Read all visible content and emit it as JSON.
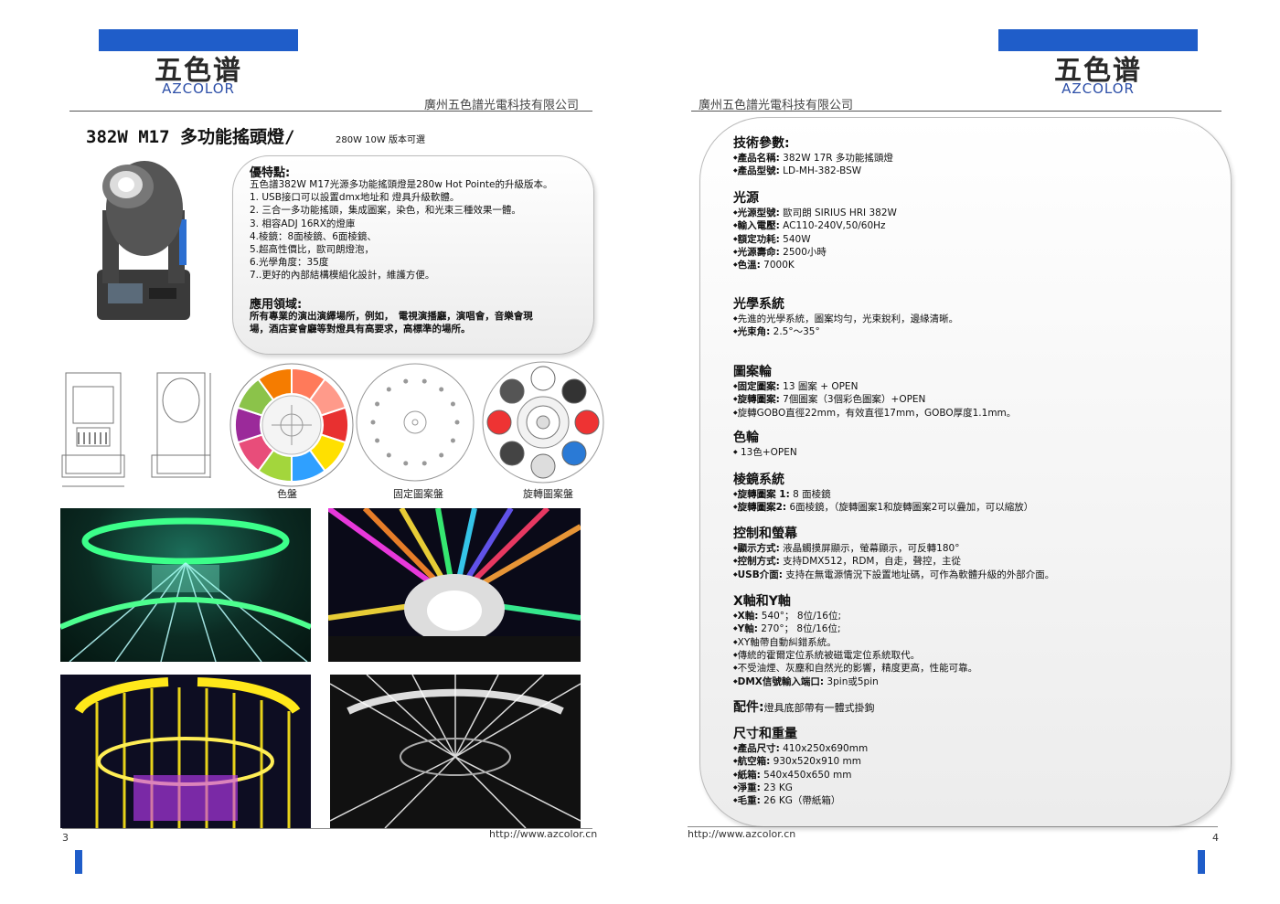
{
  "logo": {
    "cn": "五色谱",
    "en": "AZCOLOR"
  },
  "company": "廣州五色譜光電科技有限公司",
  "left": {
    "title": "382W M17 多功能搖頭燈/",
    "subtitle": "280W 10W 版本可選",
    "features_title": "優特點:",
    "features": [
      "五色譜382W M17光源多功能搖頭燈是280w Hot Pointe的升級版本。",
      "1. USB接口可以設置dmx地址和 燈具升級軟體。",
      "2. 三合一多功能搖頭，集成圖案，染色，和光束三種效果一體。",
      "3. 相容ADJ 16RX的燈庫",
      "4.棱鏡：8面棱鏡、6面棱鏡、",
      "5.超高性價比，歐司朗燈泡，",
      "6.光學角度：35度",
      "7..更好的內部結構模組化設計，維護方便。"
    ],
    "app_title": "應用領域:",
    "app_lines": [
      "所有專業的演出演繹場所，例如，　電視演播廳，演唱會，音樂會現",
      "場，酒店宴會廳等對燈具有高要求，高標準的場所。"
    ],
    "captions": [
      "色盤",
      "固定圖案盤",
      "旋轉圖案盤"
    ],
    "page_no": "3",
    "url": "http://www.azcolor.cn"
  },
  "right": {
    "page_no": "4",
    "url": "http://www.azcolor.cn",
    "sections": [
      {
        "title": "技術參數:",
        "items": [
          {
            "k": "產品名稱:",
            "v": " 382W 17R 多功能搖頭燈"
          },
          {
            "k": "產品型號:",
            "v": " LD-MH-382-BSW"
          }
        ]
      },
      {
        "title": "光源",
        "items": [
          {
            "k": "光源型號:",
            "v": " 歐司朗 SIRIUS HRI 382W"
          },
          {
            "k": "輸入電壓:",
            "v": " AC110-240V,50/60Hz"
          },
          {
            "k": "額定功耗:",
            "v": " 540W"
          },
          {
            "k": "光源壽命:",
            "v": " 2500小時"
          },
          {
            "k": "色溫:",
            "v": " 7000K"
          }
        ]
      },
      {
        "title": "光學系統",
        "items": [
          {
            "k": "",
            "v": "先進的光學系統，圖案均勻，光束銳利，邊緣清晰。"
          },
          {
            "k": "光束角:",
            "v": " 2.5°～35°"
          }
        ]
      },
      {
        "title": "圖案輪",
        "items": [
          {
            "k": "固定圖案:",
            "v": " 13 圖案 + OPEN"
          },
          {
            "k": "旋轉圖案:",
            "v": " 7個圖案（3個彩色圖案）+OPEN"
          },
          {
            "k": "",
            "v": "旋轉GOBO直徑22mm，有效直徑17mm，GOBO厚度1.1mm。"
          }
        ]
      },
      {
        "title": "色輪",
        "items": [
          {
            "k": "",
            "v": " 13色+OPEN"
          }
        ]
      },
      {
        "title": "棱鏡系統",
        "items": [
          {
            "k": "旋轉圖案 1:",
            "v": " 8 面棱鏡"
          },
          {
            "k": "旋轉圖案2:",
            "v": " 6面棱鏡，（旋轉圖案1和旋轉圖案2可以疊加，可以縮放）"
          }
        ]
      },
      {
        "title": "控制和螢幕",
        "items": [
          {
            "k": "顯示方式:",
            "v": " 液晶觸摸屏顯示，螢幕顯示，可反轉180°"
          },
          {
            "k": "控制方式:",
            "v": " 支持DMX512，RDM，自走，聲控，主從"
          },
          {
            "k": "USB介面:",
            "v": " 支持在無電源情況下設置地址碼，可作為軟體升級的外部介面。"
          }
        ]
      },
      {
        "title": "X軸和Y軸",
        "items": [
          {
            "k": "X軸:",
            "v": " 540°；  8位/16位;"
          },
          {
            "k": "Y軸:",
            "v": " 270°；  8位/16位;"
          },
          {
            "k": "",
            "v": "XY軸帶自動糾錯系統。"
          },
          {
            "k": "",
            "v": "傳統的霍爾定位系統被磁電定位系統取代。"
          },
          {
            "k": "",
            "v": "不受油煙、灰塵和自然光的影響，精度更高，性能可靠。"
          },
          {
            "k": "DMX信號輸入端口:",
            "v": " 3pin或5pin"
          }
        ]
      },
      {
        "title": "配件:",
        "inline": "燈具底部帶有一體式掛鉤",
        "items": []
      },
      {
        "title": "尺寸和重量",
        "items": [
          {
            "k": "產品尺寸:",
            "v": " 410x250x690mm"
          },
          {
            "k": "航空箱:",
            "v": " 930x520x910 mm"
          },
          {
            "k": "紙箱:",
            "v": " 540x450x650 mm"
          },
          {
            "k": "淨重:",
            "v": " 23 KG"
          },
          {
            "k": "毛重:",
            "v": " 26 KG（帶紙箱）"
          }
        ]
      }
    ]
  },
  "colors": {
    "brand_blue": "#1f5dc9"
  }
}
